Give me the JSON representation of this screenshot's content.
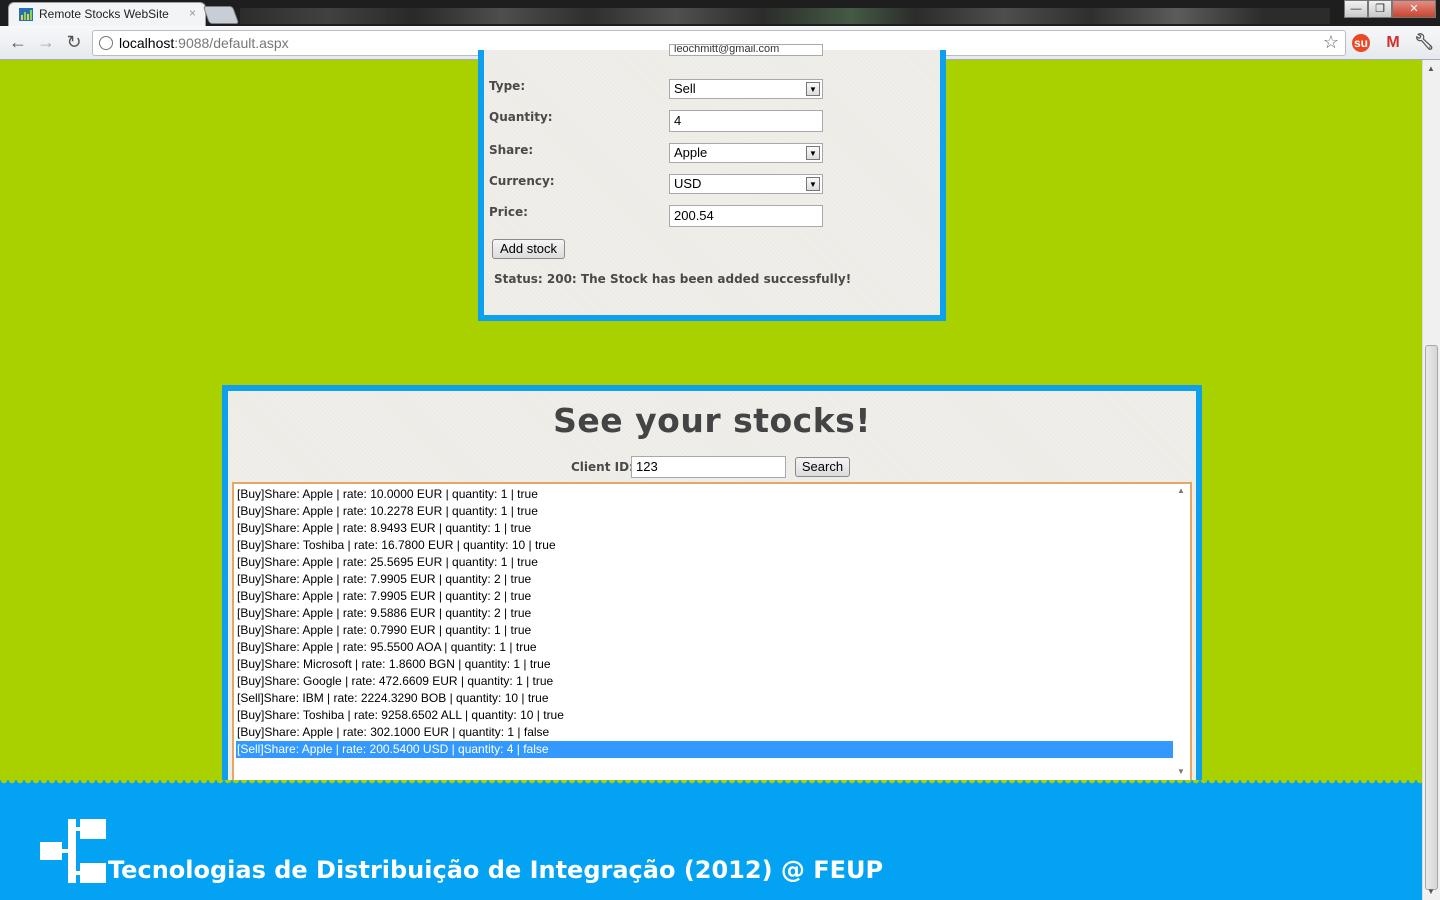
{
  "browser": {
    "tab_title": "Remote Stocks WebSite",
    "tab_close": "×",
    "url_host": "localhost",
    "url_rest": ":9088/default.aspx",
    "win_minimize": "—",
    "win_maximize": "❐",
    "win_close": "✕"
  },
  "add_form": {
    "email_partial": "leochmitt@gmail.com",
    "type_label": "Type:",
    "type_value": "Sell",
    "quantity_label": "Quantity:",
    "quantity_value": "4",
    "share_label": "Share:",
    "share_value": "Apple",
    "currency_label": "Currency:",
    "currency_value": "USD",
    "price_label": "Price:",
    "price_value": "200.54",
    "add_button": "Add stock",
    "status": "Status: 200: The Stock has been added successfully!"
  },
  "see_stocks": {
    "title": "See your stocks!",
    "client_label": "Client ID:",
    "client_value": "123",
    "search_button": "Search",
    "items": [
      "[Buy]Share: Apple | rate: 10.0000 EUR | quantity: 1 | true",
      "[Buy]Share: Apple | rate: 10.2278 EUR | quantity: 1 | true",
      "[Buy]Share: Apple | rate: 8.9493 EUR | quantity: 1 | true",
      "[Buy]Share: Toshiba | rate: 16.7800 EUR | quantity: 10 | true",
      "[Buy]Share: Apple | rate: 25.5695 EUR | quantity: 1 | true",
      "[Buy]Share: Apple | rate: 7.9905 EUR | quantity: 2 | true",
      "[Buy]Share: Apple | rate: 7.9905 EUR | quantity: 2 | true",
      "[Buy]Share: Apple | rate: 9.5886 EUR | quantity: 2 | true",
      "[Buy]Share: Apple | rate: 0.7990 EUR | quantity: 1 | true",
      "[Buy]Share: Apple | rate: 95.5500 AOA | quantity: 1 | true",
      "[Buy]Share: Microsoft | rate: 1.8600 BGN | quantity: 1 | true",
      "[Buy]Share: Google | rate: 472.6609 EUR | quantity: 1 | true",
      "[Sell]Share: IBM | rate: 2224.3290 BOB | quantity: 10 | true",
      "[Buy]Share: Toshiba | rate: 9258.6502 ALL | quantity: 10 | true",
      "[Buy]Share: Apple | rate: 302.1000 EUR | quantity: 1 | false",
      "[Sell]Share: Apple | rate: 200.5400 USD | quantity: 4 | false"
    ],
    "selected_index": 15
  },
  "footer": {
    "text": "Tecnologias de Distribuição de Integração (2012) @ FEUP"
  },
  "colors": {
    "page_bg": "#a9d100",
    "panel_border": "#0ea0ec",
    "footer_bg": "#04a2f3",
    "selection": "#3399ff"
  },
  "icons": [
    "back-icon",
    "forward-icon",
    "reload-icon",
    "globe-icon",
    "star-icon",
    "stumbleupon-icon",
    "gmail-icon",
    "wrench-icon",
    "dropdown-arrow-icon",
    "feup-logo"
  ]
}
